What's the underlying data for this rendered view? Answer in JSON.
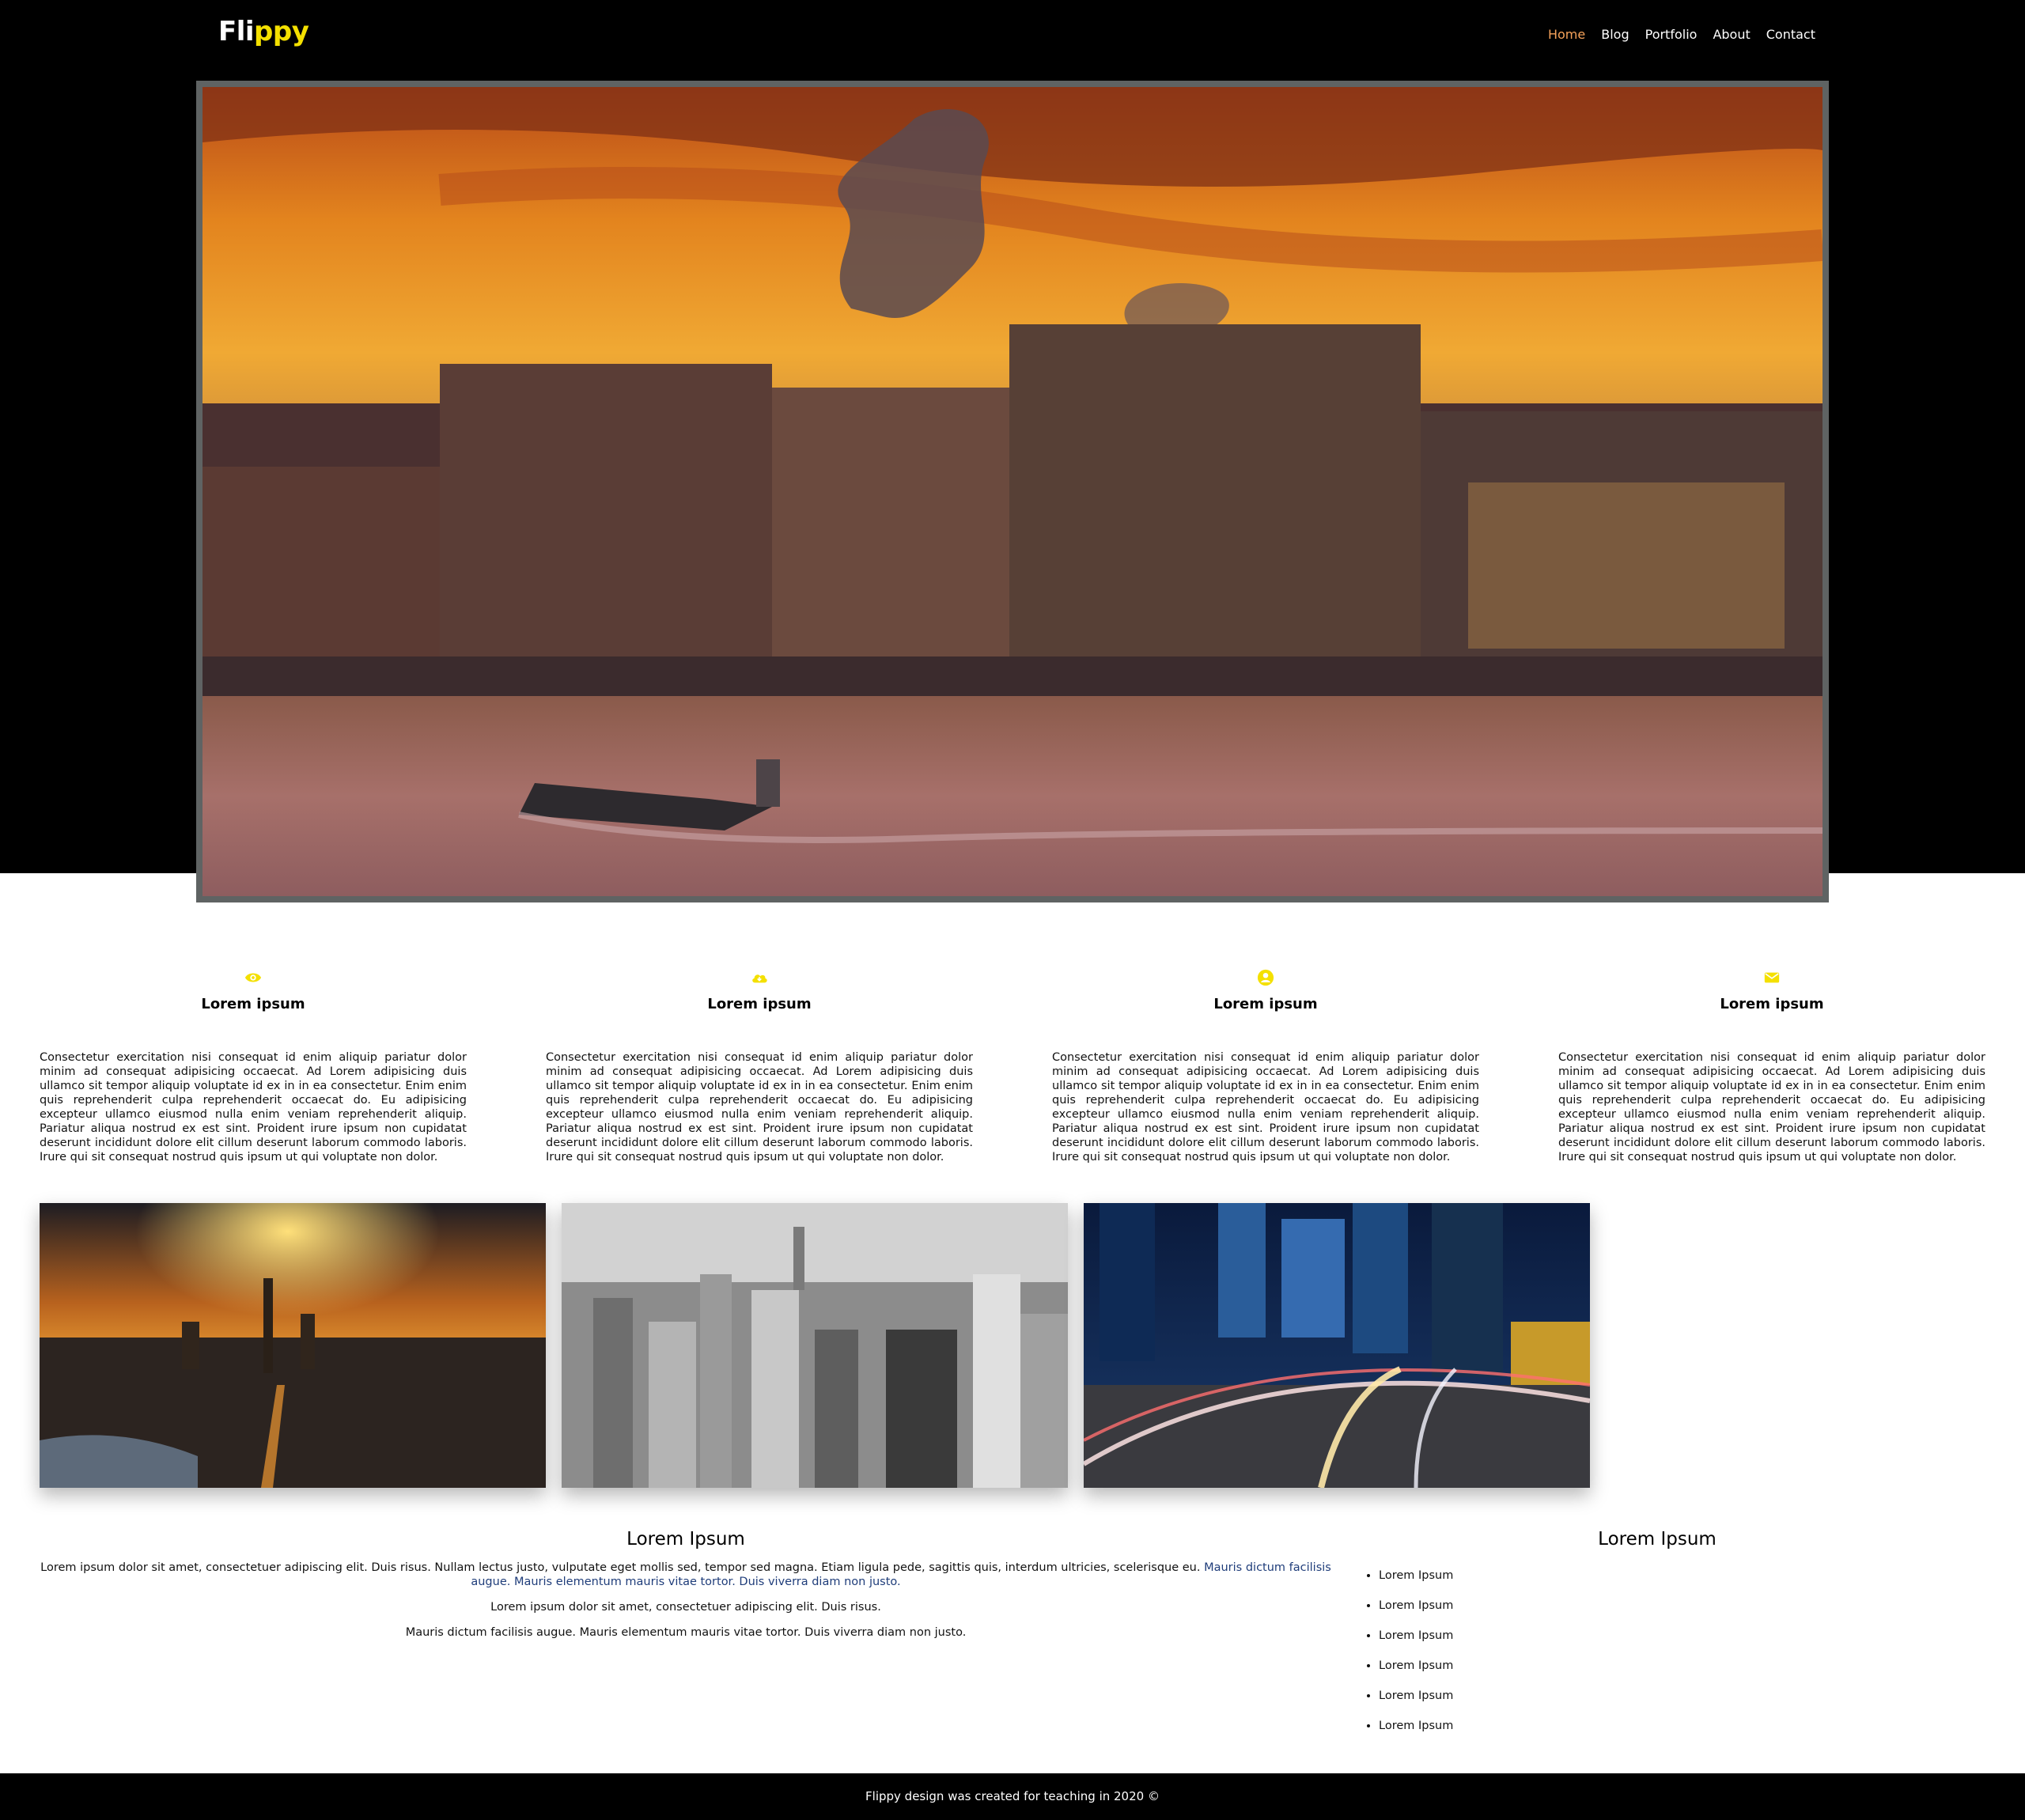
{
  "brand": {
    "logo_plain": "Fli",
    "logo_highlight": "ppy"
  },
  "nav": {
    "items": [
      "Home",
      "Blog",
      "Portfolio",
      "About",
      "Contact"
    ],
    "active": "Home"
  },
  "colors": {
    "accent": "#f4e000",
    "nav_active": "#f5a25a",
    "hero_border": "#5f6363"
  },
  "features": [
    {
      "icon": "eye-icon",
      "title": "Lorem ipsum",
      "text": "Consectetur exercitation nisi consequat id enim aliquip pariatur dolor minim ad consequat adipisicing occaecat. Ad Lorem adipisicing duis ullamco sit tempor aliquip voluptate id ex in in ea consectetur. Enim enim quis reprehenderit culpa reprehenderit occaecat do. Eu adipisicing excepteur ullamco eiusmod nulla enim veniam reprehenderit aliquip. Pariatur aliqua nostrud ex est sint. Proident irure ipsum non cupidatat deserunt incididunt dolore elit cillum deserunt laborum commodo laboris. Irure qui sit consequat nostrud quis ipsum ut qui voluptate non dolor."
    },
    {
      "icon": "cloud-download-icon",
      "title": "Lorem ipsum",
      "text": "Consectetur exercitation nisi consequat id enim aliquip pariatur dolor minim ad consequat adipisicing occaecat. Ad Lorem adipisicing duis ullamco sit tempor aliquip voluptate id ex in in ea consectetur. Enim enim quis reprehenderit culpa reprehenderit occaecat do. Eu adipisicing excepteur ullamco eiusmod nulla enim veniam reprehenderit aliquip. Pariatur aliqua nostrud ex est sint. Proident irure ipsum non cupidatat deserunt incididunt dolore elit cillum deserunt laborum commodo laboris. Irure qui sit consequat nostrud quis ipsum ut qui voluptate non dolor."
    },
    {
      "icon": "user-circle-icon",
      "title": "Lorem ipsum",
      "text": "Consectetur exercitation nisi consequat id enim aliquip pariatur dolor minim ad consequat adipisicing occaecat. Ad Lorem adipisicing duis ullamco sit tempor aliquip voluptate id ex in in ea consectetur. Enim enim quis reprehenderit culpa reprehenderit occaecat do. Eu adipisicing excepteur ullamco eiusmod nulla enim veniam reprehenderit aliquip. Pariatur aliqua nostrud ex est sint. Proident irure ipsum non cupidatat deserunt incididunt dolore elit cillum deserunt laborum commodo laboris. Irure qui sit consequat nostrud quis ipsum ut qui voluptate non dolor."
    },
    {
      "icon": "envelope-icon",
      "title": "Lorem ipsum",
      "text": "Consectetur exercitation nisi consequat id enim aliquip pariatur dolor minim ad consequat adipisicing occaecat. Ad Lorem adipisicing duis ullamco sit tempor aliquip voluptate id ex in in ea consectetur. Enim enim quis reprehenderit culpa reprehenderit occaecat do. Eu adipisicing excepteur ullamco eiusmod nulla enim veniam reprehenderit aliquip. Pariatur aliqua nostrud ex est sint. Proident irure ipsum non cupidatat deserunt incididunt dolore elit cillum deserunt laborum commodo laboris. Irure qui sit consequat nostrud quis ipsum ut qui voluptate non dolor."
    }
  ],
  "main": {
    "title": "Lorem Ipsum",
    "p1_text": "Lorem ipsum dolor sit amet, consectetuer adipiscing elit. Duis risus. Nullam lectus justo, vulputate eget mollis sed, tempor sed magna. Etiam ligula pede, sagittis quis, interdum ultricies, scelerisque eu. ",
    "p1_link": "Mauris dictum facilisis augue. Mauris elementum mauris vitae tortor. Duis viverra diam non justo.",
    "p2": "Lorem ipsum dolor sit amet, consectetuer adipiscing elit. Duis risus.",
    "p3": "Mauris dictum facilisis augue. Mauris elementum mauris vitae tortor. Duis viverra diam non justo."
  },
  "sidebar": {
    "title": "Lorem Ipsum",
    "items": [
      "Lorem Ipsum",
      "Lorem Ipsum",
      "Lorem Ipsum",
      "Lorem Ipsum",
      "Lorem Ipsum",
      "Lorem Ipsum"
    ]
  },
  "footer": {
    "text": "Flippy design was created for teaching in 2020 ©"
  }
}
